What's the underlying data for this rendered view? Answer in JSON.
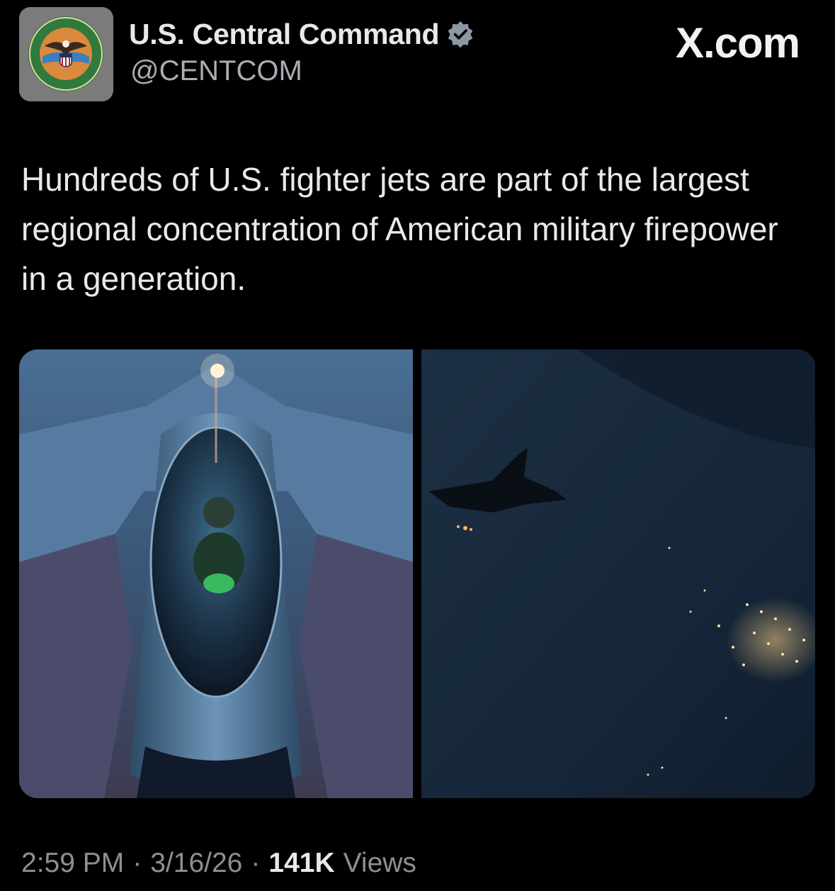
{
  "account": {
    "display_name": "U.S. Central Command",
    "handle": "@CENTCOM",
    "verified_icon": "verified-badge-icon",
    "avatar_seal_text_top": "UNITED STATES",
    "avatar_seal_text_bottom": "CENTRAL COMMAND"
  },
  "brand": {
    "label": "X.com"
  },
  "tweet": {
    "text": "Hundreds of U.S. fighter jets are part of the largest regional concentration of American military firepower in a generation."
  },
  "media": [
    {
      "kind": "photo",
      "icon": "fighter-jet-cockpit-photo"
    },
    {
      "kind": "photo",
      "icon": "fighter-jet-night-city-photo"
    }
  ],
  "meta": {
    "time": "2:59 PM",
    "separator": "·",
    "date": "3/16/26",
    "views_count": "141K",
    "views_label": "Views"
  },
  "colors": {
    "background": "#000000",
    "text_primary": "#e7e9ea",
    "text_secondary": "#8b9096",
    "verified_badge": "#8b98a5"
  }
}
